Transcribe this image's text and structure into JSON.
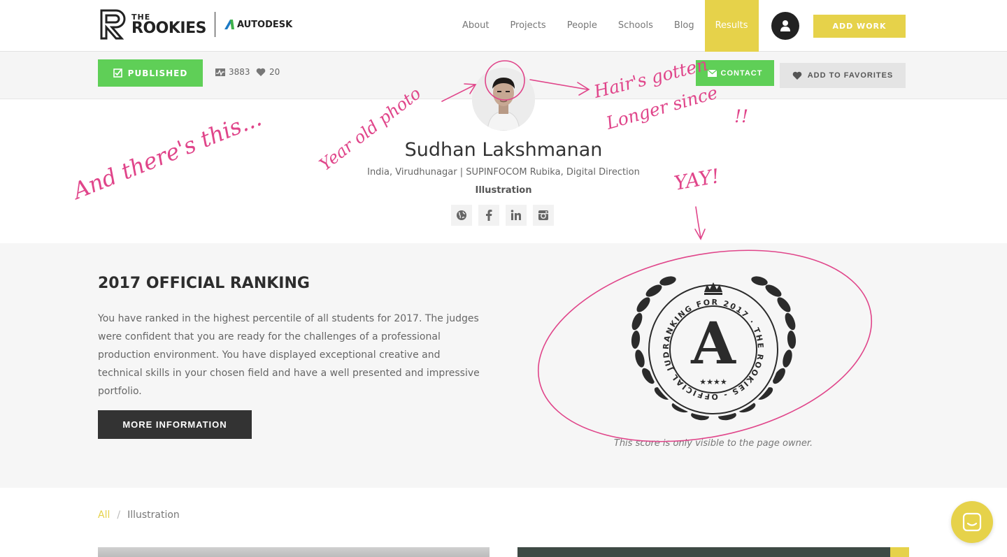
{
  "header": {
    "logo_the": "THE",
    "logo_rookies": "ROOKIES",
    "partner": "AUTODESK",
    "nav": [
      {
        "label": "About"
      },
      {
        "label": "Projects"
      },
      {
        "label": "People"
      },
      {
        "label": "Schools"
      },
      {
        "label": "Blog"
      },
      {
        "label": "Results",
        "active": true
      }
    ],
    "add_work": "ADD WORK"
  },
  "subbar": {
    "published": "PUBLISHED",
    "views": "3883",
    "likes": "20",
    "contact": "CONTACT",
    "favorites": "ADD TO FAVORITES"
  },
  "profile": {
    "name": "Sudhan Lakshmanan",
    "location": "India, Virudhunagar | SUPINFOCOM Rubika, Digital Direction",
    "discipline": "Illustration",
    "socials": [
      "globe-icon",
      "facebook-icon",
      "linkedin-icon",
      "instagram-icon"
    ]
  },
  "ranking": {
    "title": "2017 OFFICIAL RANKING",
    "text": "You have ranked in the highest percentile of all students for 2017. The judges were confident that you are ready for the challenges of a professional production environment. You have displayed exceptional creative and technical skills in your chosen field and have a well presented and impressive portfolio.",
    "button": "MORE INFORMATION",
    "badge_grade": "A",
    "badge_ring": "RANKING FOR 2017 · THE ROOKIES - OFFICIAL JUDGES",
    "owner_note": "This score is only visible to the page owner."
  },
  "breadcrumb": {
    "all": "All",
    "separator": "/",
    "current": "Illustration"
  },
  "annotations": {
    "left": "And there's this...",
    "photo": "Year old photo",
    "hair_1": "Hair's gotten",
    "hair_2": "Longer since",
    "hair_3": "!!",
    "yay": "YAY!"
  },
  "colors": {
    "accent_yellow": "#e6d24a",
    "green": "#5fcf57",
    "dark": "#333333",
    "annotation_pink": "#e0458a"
  }
}
